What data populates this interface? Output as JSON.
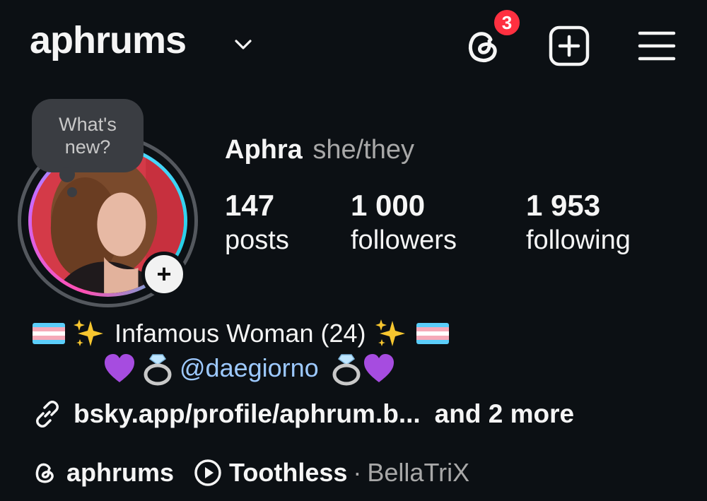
{
  "header": {
    "username": "aphrums",
    "threads_badge_count": "3"
  },
  "note": {
    "line1": "What's",
    "line2": "new?"
  },
  "profile": {
    "display_name": "Aphra",
    "pronouns": "she/they"
  },
  "stats": [
    {
      "value": "147",
      "label": "posts"
    },
    {
      "value": "1 000",
      "label": "followers"
    },
    {
      "value": "1 953",
      "label": "following"
    }
  ],
  "bio": {
    "line1_text": "Infamous Woman (24)",
    "mention": "@daegiorno"
  },
  "link": {
    "text": "bsky.app/profile/aphrum.b...",
    "more": "and 2 more"
  },
  "chips": {
    "threads_handle": "aphrums",
    "song_title": "Toothless",
    "separator": "·",
    "song_artist": "BellaTriX"
  },
  "icons": {
    "threads": "threads-icon",
    "create": "plus-square-icon",
    "menu": "hamburger-menu-icon",
    "link": "link-icon",
    "play": "play-circle-icon"
  },
  "colors": {
    "background": "#0c1014",
    "badge": "#ff3040",
    "mention": "#9dc9ff",
    "secondary_text": "#a8a8a8"
  }
}
